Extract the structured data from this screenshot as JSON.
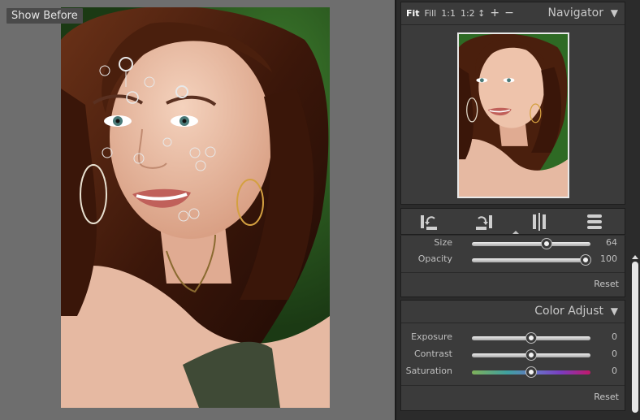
{
  "canvas": {
    "show_before_label": "Show Before"
  },
  "navigator": {
    "title": "Navigator",
    "zoom_options": [
      "Fit",
      "Fill",
      "1:1",
      "1:2 ↕"
    ],
    "active_zoom": "Fit",
    "zoom_in": "+",
    "zoom_out": "−",
    "collapse": "▼"
  },
  "tools": [
    {
      "icon": "rotate-left-icon"
    },
    {
      "icon": "rotate-right-icon"
    },
    {
      "icon": "compare-split-icon"
    },
    {
      "icon": "layers-menu-icon"
    }
  ],
  "brush": {
    "sliders": [
      {
        "label": "Size",
        "value": "64",
        "fraction": 0.63
      },
      {
        "label": "Opacity",
        "value": "100",
        "fraction": 0.96
      }
    ],
    "reset": "Reset"
  },
  "color_adjust": {
    "title": "Color Adjust",
    "collapse": "▼",
    "sliders": [
      {
        "label": "Exposure",
        "value": "0",
        "fraction": 0.5
      },
      {
        "label": "Contrast",
        "value": "0",
        "fraction": 0.5
      },
      {
        "label": "Saturation",
        "value": "0",
        "fraction": 0.5
      }
    ],
    "reset": "Reset"
  },
  "colors": {
    "panel_bg": "#2b2b2b",
    "box_bg": "#3b3b3b",
    "canvas_bg": "#6e6e6e"
  }
}
